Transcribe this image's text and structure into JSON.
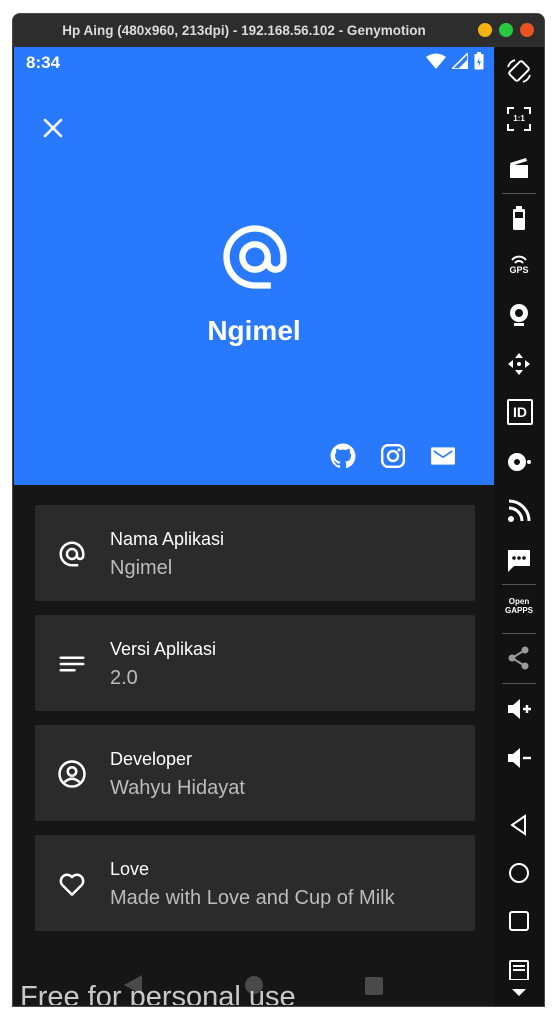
{
  "window": {
    "title": "Hp Aing (480x960, 213dpi) - 192.168.56.102 - Genymotion",
    "dots": [
      "#f5b30f",
      "#27c93f",
      "#e95420"
    ]
  },
  "status_bar": {
    "time": "8:34"
  },
  "hero": {
    "app_name": "Ngimel",
    "bg_color": "#2979ff",
    "social_icons": [
      "github-icon",
      "instagram-icon",
      "mail-icon"
    ]
  },
  "info_cards": [
    {
      "icon": "at-icon",
      "label": "Nama Aplikasi",
      "value": "Ngimel"
    },
    {
      "icon": "lines-icon",
      "label": "Versi Aplikasi",
      "value": "2.0"
    },
    {
      "icon": "account-circle-icon",
      "label": "Developer",
      "value": "Wahyu Hidayat"
    },
    {
      "icon": "heart-icon",
      "label": "Love",
      "value": "Made with Love and Cup of Milk"
    }
  ],
  "watermark": "Free for personal use",
  "side_toolbar": {
    "open_gapps_label": "Open GAPPS",
    "gps_label": "GPS",
    "id_label": "ID",
    "scale_label": "1:1"
  }
}
